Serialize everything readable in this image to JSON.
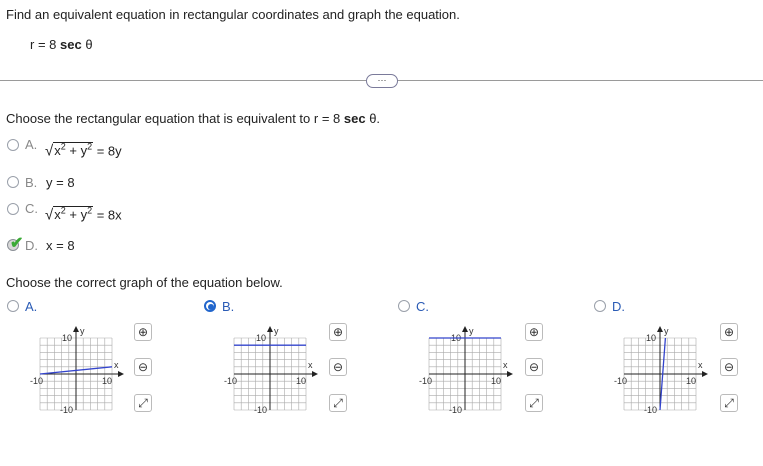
{
  "question": {
    "text": "Find an equivalent equation in rectangular coordinates and graph the equation.",
    "given_lhs": "r = 8 ",
    "given_sec": "sec",
    "given_theta": " θ"
  },
  "more_button": "···",
  "part1": {
    "prompt_prefix": "Choose the rectangular equation that is equivalent to r = 8 ",
    "prompt_sec": "sec",
    "prompt_suffix": " θ.",
    "options": [
      {
        "letter": "A.",
        "radicand_x": "x",
        "radicand_exp1": "2",
        "plus": " + ",
        "radicand_y": "y",
        "radicand_exp2": "2",
        "rhs": " = 8y"
      },
      {
        "letter": "B.",
        "text": "y = 8"
      },
      {
        "letter": "C.",
        "radicand_x": "x",
        "radicand_exp1": "2",
        "plus": " + ",
        "radicand_y": "y",
        "radicand_exp2": "2",
        "rhs": " = 8x"
      },
      {
        "letter": "D.",
        "text": "x = 8"
      }
    ],
    "selected": "D",
    "correct_mark": "✔"
  },
  "part2": {
    "prompt": "Choose the correct graph of the equation below.",
    "options": [
      {
        "letter": "A."
      },
      {
        "letter": "B."
      },
      {
        "letter": "C."
      },
      {
        "letter": "D."
      }
    ],
    "selected": "B",
    "axis_labels": {
      "y": "y",
      "x": "x",
      "top": "10",
      "bottom": "-10",
      "left": "-10",
      "right": "10"
    }
  },
  "graph_data": [
    {
      "name": "A",
      "line": [
        [
          -10,
          0
        ],
        [
          10,
          2
        ]
      ]
    },
    {
      "name": "B",
      "line": [
        [
          -10,
          8
        ],
        [
          10,
          8
        ]
      ]
    },
    {
      "name": "C",
      "line": [
        [
          -10,
          10
        ],
        [
          10,
          10
        ]
      ],
      "hline_at_top": true
    },
    {
      "name": "D",
      "line": [
        [
          0,
          -10
        ],
        [
          1.5,
          10
        ]
      ]
    }
  ],
  "colors": {
    "accent": "#2266cc",
    "line": "#3344cc",
    "check": "#3aaa35"
  },
  "tool_icons": [
    "zoom-in-icon",
    "zoom-out-icon",
    "expand-icon"
  ]
}
